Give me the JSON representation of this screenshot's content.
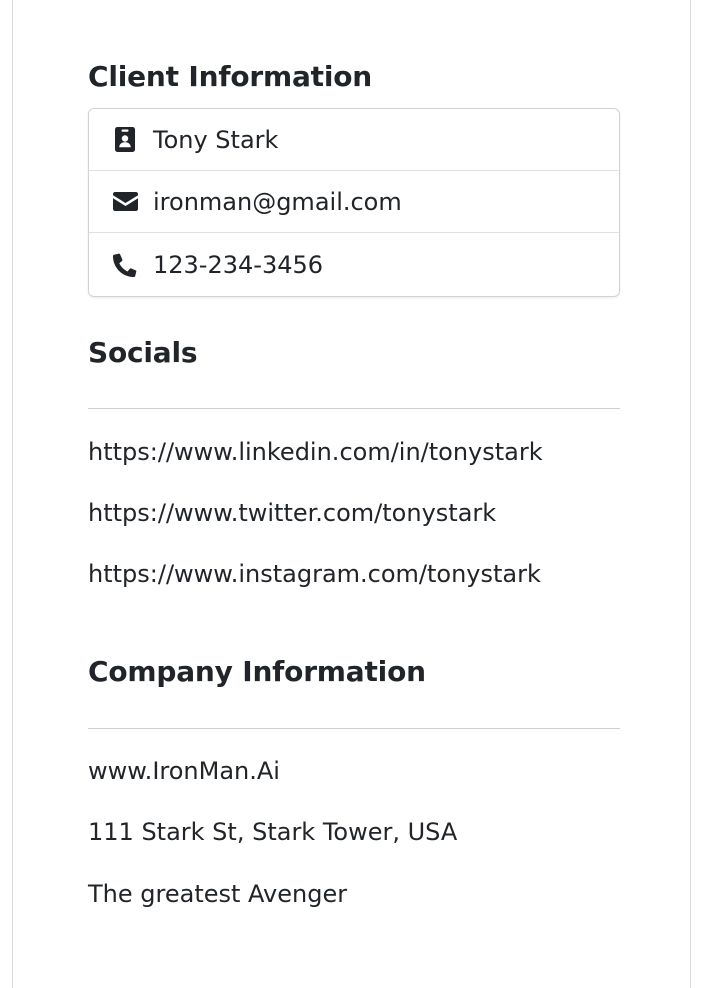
{
  "client": {
    "title": "Client Information",
    "items": [
      {
        "icon": "id-badge-icon",
        "text": "Tony Stark"
      },
      {
        "icon": "envelope-icon",
        "text": "ironman@gmail.com"
      },
      {
        "icon": "phone-icon",
        "text": "123-234-3456"
      }
    ]
  },
  "socials": {
    "title": "Socials",
    "links": [
      "https://www.linkedin.com/in/tonystark",
      "https://www.twitter.com/tonystark",
      "https://www.instagram.com/tonystark"
    ]
  },
  "company": {
    "title": "Company Information",
    "website": "www.IronMan.Ai",
    "address": "111 Stark St, Stark Tower, USA",
    "description": "The greatest Avenger"
  },
  "colors": {
    "text": "#212529",
    "border": "#dee2e6"
  }
}
